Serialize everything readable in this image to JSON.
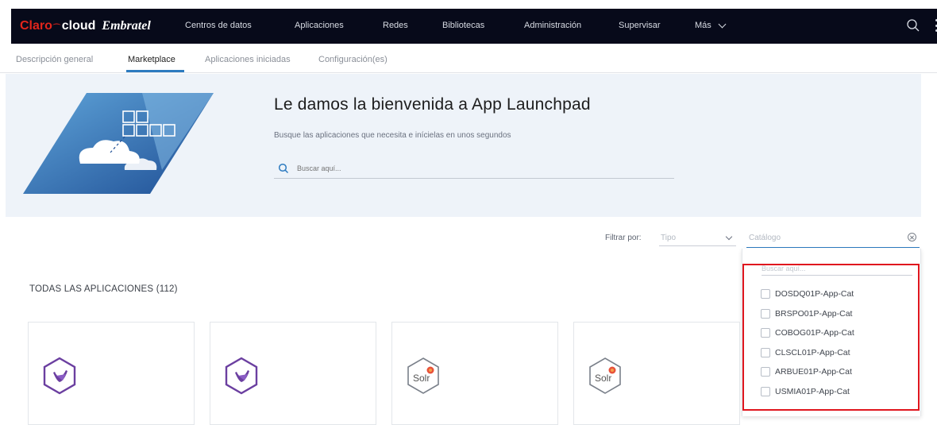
{
  "brand": {
    "claro": "Claro",
    "cloud": "cloud",
    "embratel": "Embratel"
  },
  "nav": {
    "items": [
      "Centros de datos",
      "Aplicaciones",
      "Redes",
      "Bibliotecas",
      "Administración",
      "Supervisar"
    ],
    "more": "Más"
  },
  "subtabs": [
    "Descripción general",
    "Marketplace",
    "Aplicaciones iniciadas",
    "Configuración(es)"
  ],
  "hero": {
    "title": "Le damos la bienvenida a App Launchpad",
    "subtitle": "Busque las aplicaciones que necesita e inícielas en unos segundos",
    "search_placeholder": "Buscar aquí..."
  },
  "filter": {
    "label": "Filtrar por:",
    "type_placeholder": "Tipo",
    "catalog_placeholder": "Catálogo"
  },
  "dropdown": {
    "search_placeholder": "Buscar aquí...",
    "items": [
      "DOSDQ01P-App-Cat",
      "BRSPO01P-App-Cat",
      "COBOG01P-App-Cat",
      "CLSCL01P-App-Cat",
      "ARBUE01P-App-Cat",
      "USMIA01P-App-Cat"
    ]
  },
  "section": {
    "title": "TODAS LAS APLICACIONES (112)"
  },
  "cards": [
    {
      "icon": "hexagon-app-icon"
    },
    {
      "icon": "hexagon-app-icon"
    },
    {
      "icon": "solr-icon",
      "label": "Solr"
    },
    {
      "icon": "solr-icon",
      "label": "Solr"
    }
  ],
  "colors": {
    "topbar": "#070a1a",
    "accent": "#2d7bc0",
    "brand_red": "#e1251b",
    "highlight": "#e0161e",
    "hero_bg": "#eef3f9"
  }
}
